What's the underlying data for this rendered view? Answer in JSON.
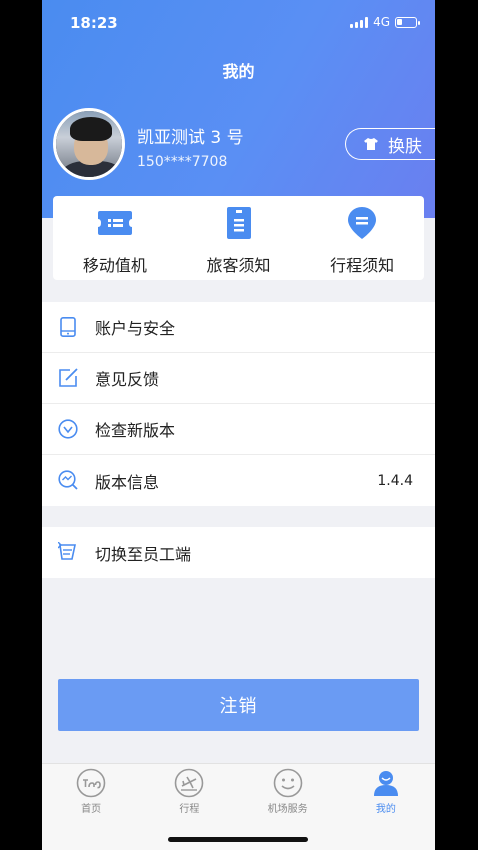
{
  "status_bar": {
    "time": "18:23",
    "network": "4G"
  },
  "header": {
    "title": "我的"
  },
  "user": {
    "name": "凯亚测试 3 号",
    "phone": "150****7708"
  },
  "skin_button": {
    "label": "换肤",
    "icon": "shirt-icon"
  },
  "quick_actions": [
    {
      "label": "移动值机",
      "icon": "ticket-icon"
    },
    {
      "label": "旅客须知",
      "icon": "document-icon"
    },
    {
      "label": "行程须知",
      "icon": "location-pin-icon"
    }
  ],
  "menu": {
    "account_security": "账户与安全",
    "feedback": "意见反馈",
    "check_update": "检查新版本",
    "version_info": "版本信息",
    "version_value": "1.4.4",
    "switch_staff": "切换至员工端"
  },
  "logout_label": "注销",
  "tabs": [
    {
      "label": "首页",
      "icon": "home-logo-icon",
      "active": false
    },
    {
      "label": "行程",
      "icon": "plane-icon",
      "active": false
    },
    {
      "label": "机场服务",
      "icon": "smile-icon",
      "active": false
    },
    {
      "label": "我的",
      "icon": "person-icon",
      "active": true
    }
  ],
  "colors": {
    "accent": "#4a8cf0",
    "logout_button": "#6a9bf3",
    "background": "#f0f1f5"
  }
}
